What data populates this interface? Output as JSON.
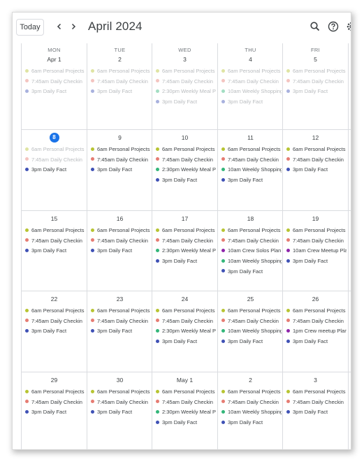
{
  "toolbar": {
    "today_label": "Today",
    "month_title": "April 2024",
    "icons": [
      "chevron-left-icon",
      "chevron-right-icon",
      "search-icon",
      "help-icon",
      "settings-icon"
    ]
  },
  "colors": {
    "personal": "#b7c432",
    "checkin": "#e67c73",
    "fact": "#3f51b5",
    "meal": "#33b679",
    "shopping": "#33b679",
    "crew": "#8e24aa",
    "today": "#1a73e8"
  },
  "days": [
    "MON",
    "TUE",
    "WED",
    "THU",
    "FRI"
  ],
  "weeks": [
    [
      {
        "date": "Apr 1",
        "events": [
          {
            "time": "6am",
            "title": "Personal Projects",
            "type": "personal",
            "past": true
          },
          {
            "time": "7:45am",
            "title": "Daily Checkin",
            "type": "checkin",
            "past": true
          },
          {
            "time": "3pm",
            "title": "Daily Fact",
            "type": "fact",
            "past": true
          }
        ]
      },
      {
        "date": "2",
        "events": [
          {
            "time": "6am",
            "title": "Personal Projects",
            "type": "personal",
            "past": true
          },
          {
            "time": "7:45am",
            "title": "Daily Checkin",
            "type": "checkin",
            "past": true
          },
          {
            "time": "3pm",
            "title": "Daily Fact",
            "type": "fact",
            "past": true
          }
        ]
      },
      {
        "date": "3",
        "events": [
          {
            "time": "6am",
            "title": "Personal Projects",
            "type": "personal",
            "past": true
          },
          {
            "time": "7:45am",
            "title": "Daily Checkin",
            "type": "checkin",
            "past": true
          },
          {
            "time": "2:30pm",
            "title": "Weekly Meal Prep",
            "type": "meal",
            "past": true
          },
          {
            "time": "3pm",
            "title": "Daily Fact",
            "type": "fact",
            "past": true
          }
        ]
      },
      {
        "date": "4",
        "events": [
          {
            "time": "6am",
            "title": "Personal Projects",
            "type": "personal",
            "past": true
          },
          {
            "time": "7:45am",
            "title": "Daily Checkin",
            "type": "checkin",
            "past": true
          },
          {
            "time": "10am",
            "title": "Weekly Shopping",
            "type": "shopping",
            "past": true
          },
          {
            "time": "3pm",
            "title": "Daily Fact",
            "type": "fact",
            "past": true
          }
        ]
      },
      {
        "date": "5",
        "events": [
          {
            "time": "6am",
            "title": "Personal Projects",
            "type": "personal",
            "past": true
          },
          {
            "time": "7:45am",
            "title": "Daily Checkin",
            "type": "checkin",
            "past": true
          },
          {
            "time": "3pm",
            "title": "Daily Fact",
            "type": "fact",
            "past": true
          }
        ]
      }
    ],
    [
      {
        "date": "8",
        "today": true,
        "events": [
          {
            "time": "6am",
            "title": "Personal Projects",
            "type": "personal",
            "past": true
          },
          {
            "time": "7:45am",
            "title": "Daily Checkin",
            "type": "checkin",
            "past": true
          },
          {
            "time": "3pm",
            "title": "Daily Fact",
            "type": "fact",
            "past": false
          }
        ]
      },
      {
        "date": "9",
        "events": [
          {
            "time": "6am",
            "title": "Personal Projects",
            "type": "personal"
          },
          {
            "time": "7:45am",
            "title": "Daily Checkin",
            "type": "checkin"
          },
          {
            "time": "3pm",
            "title": "Daily Fact",
            "type": "fact"
          }
        ]
      },
      {
        "date": "10",
        "events": [
          {
            "time": "6am",
            "title": "Personal Projects",
            "type": "personal"
          },
          {
            "time": "7:45am",
            "title": "Daily Checkin",
            "type": "checkin"
          },
          {
            "time": "2:30pm",
            "title": "Weekly Meal Prep",
            "type": "meal"
          },
          {
            "time": "3pm",
            "title": "Daily Fact",
            "type": "fact"
          }
        ]
      },
      {
        "date": "11",
        "events": [
          {
            "time": "6am",
            "title": "Personal Projects",
            "type": "personal"
          },
          {
            "time": "7:45am",
            "title": "Daily Checkin",
            "type": "checkin"
          },
          {
            "time": "10am",
            "title": "Weekly Shopping",
            "type": "shopping"
          },
          {
            "time": "3pm",
            "title": "Daily Fact",
            "type": "fact"
          }
        ]
      },
      {
        "date": "12",
        "events": [
          {
            "time": "6am",
            "title": "Personal Projects",
            "type": "personal"
          },
          {
            "time": "7:45am",
            "title": "Daily Checkin",
            "type": "checkin"
          },
          {
            "time": "3pm",
            "title": "Daily Fact",
            "type": "fact"
          }
        ]
      }
    ],
    [
      {
        "date": "15",
        "events": [
          {
            "time": "6am",
            "title": "Personal Projects",
            "type": "personal"
          },
          {
            "time": "7:45am",
            "title": "Daily Checkin",
            "type": "checkin"
          },
          {
            "time": "3pm",
            "title": "Daily Fact",
            "type": "fact"
          }
        ]
      },
      {
        "date": "16",
        "events": [
          {
            "time": "6am",
            "title": "Personal Projects",
            "type": "personal"
          },
          {
            "time": "7:45am",
            "title": "Daily Checkin",
            "type": "checkin"
          },
          {
            "time": "3pm",
            "title": "Daily Fact",
            "type": "fact"
          }
        ]
      },
      {
        "date": "17",
        "events": [
          {
            "time": "6am",
            "title": "Personal Projects",
            "type": "personal"
          },
          {
            "time": "7:45am",
            "title": "Daily Checkin",
            "type": "checkin"
          },
          {
            "time": "2:30pm",
            "title": "Weekly Meal Prep",
            "type": "meal"
          },
          {
            "time": "3pm",
            "title": "Daily Fact",
            "type": "fact"
          }
        ]
      },
      {
        "date": "18",
        "events": [
          {
            "time": "6am",
            "title": "Personal Projects",
            "type": "personal"
          },
          {
            "time": "7:45am",
            "title": "Daily Checkin",
            "type": "checkin"
          },
          {
            "time": "10am",
            "title": "Crew Solos Plan",
            "type": "crew"
          },
          {
            "time": "10am",
            "title": "Weekly Shopping",
            "type": "shopping"
          },
          {
            "time": "3pm",
            "title": "Daily Fact",
            "type": "fact"
          }
        ]
      },
      {
        "date": "19",
        "events": [
          {
            "time": "6am",
            "title": "Personal Projects",
            "type": "personal"
          },
          {
            "time": "7:45am",
            "title": "Daily Checkin",
            "type": "checkin"
          },
          {
            "time": "10am",
            "title": "Crew Meetup Plan",
            "type": "crew"
          },
          {
            "time": "3pm",
            "title": "Daily Fact",
            "type": "fact"
          }
        ]
      }
    ],
    [
      {
        "date": "22",
        "events": [
          {
            "time": "6am",
            "title": "Personal Projects",
            "type": "personal"
          },
          {
            "time": "7:45am",
            "title": "Daily Checkin",
            "type": "checkin"
          },
          {
            "time": "3pm",
            "title": "Daily Fact",
            "type": "fact"
          }
        ]
      },
      {
        "date": "23",
        "events": [
          {
            "time": "6am",
            "title": "Personal Projects",
            "type": "personal"
          },
          {
            "time": "7:45am",
            "title": "Daily Checkin",
            "type": "checkin"
          },
          {
            "time": "3pm",
            "title": "Daily Fact",
            "type": "fact"
          }
        ]
      },
      {
        "date": "24",
        "events": [
          {
            "time": "6am",
            "title": "Personal Projects",
            "type": "personal"
          },
          {
            "time": "7:45am",
            "title": "Daily Checkin",
            "type": "checkin"
          },
          {
            "time": "2:30pm",
            "title": "Weekly Meal Prep",
            "type": "meal"
          },
          {
            "time": "3pm",
            "title": "Daily Fact",
            "type": "fact"
          }
        ]
      },
      {
        "date": "25",
        "events": [
          {
            "time": "6am",
            "title": "Personal Projects",
            "type": "personal"
          },
          {
            "time": "7:45am",
            "title": "Daily Checkin",
            "type": "checkin"
          },
          {
            "time": "10am",
            "title": "Weekly Shopping",
            "type": "shopping"
          },
          {
            "time": "3pm",
            "title": "Daily Fact",
            "type": "fact"
          }
        ]
      },
      {
        "date": "26",
        "events": [
          {
            "time": "6am",
            "title": "Personal Projects",
            "type": "personal"
          },
          {
            "time": "7:45am",
            "title": "Daily Checkin",
            "type": "checkin"
          },
          {
            "time": "1pm",
            "title": "Crew meetup Plan",
            "type": "crew"
          },
          {
            "time": "3pm",
            "title": "Daily Fact",
            "type": "fact"
          }
        ]
      }
    ],
    [
      {
        "date": "29",
        "events": [
          {
            "time": "6am",
            "title": "Personal Projects",
            "type": "personal"
          },
          {
            "time": "7:45am",
            "title": "Daily Checkin",
            "type": "checkin"
          },
          {
            "time": "3pm",
            "title": "Daily Fact",
            "type": "fact"
          }
        ]
      },
      {
        "date": "30",
        "events": [
          {
            "time": "6am",
            "title": "Personal Projects",
            "type": "personal"
          },
          {
            "time": "7:45am",
            "title": "Daily Checkin",
            "type": "checkin"
          },
          {
            "time": "3pm",
            "title": "Daily Fact",
            "type": "fact"
          }
        ]
      },
      {
        "date": "May 1",
        "events": [
          {
            "time": "6am",
            "title": "Personal Projects",
            "type": "personal"
          },
          {
            "time": "7:45am",
            "title": "Daily Checkin",
            "type": "checkin"
          },
          {
            "time": "2:30pm",
            "title": "Weekly Meal Prep",
            "type": "meal"
          },
          {
            "time": "3pm",
            "title": "Daily Fact",
            "type": "fact"
          }
        ]
      },
      {
        "date": "2",
        "events": [
          {
            "time": "6am",
            "title": "Personal Projects",
            "type": "personal"
          },
          {
            "time": "7:45am",
            "title": "Daily Checkin",
            "type": "checkin"
          },
          {
            "time": "10am",
            "title": "Weekly Shopping",
            "type": "shopping"
          },
          {
            "time": "3pm",
            "title": "Daily Fact",
            "type": "fact"
          }
        ]
      },
      {
        "date": "3",
        "events": [
          {
            "time": "6am",
            "title": "Personal Projects",
            "type": "personal"
          },
          {
            "time": "7:45am",
            "title": "Daily Checkin",
            "type": "checkin"
          },
          {
            "time": "3pm",
            "title": "Daily Fact",
            "type": "fact"
          }
        ]
      }
    ]
  ]
}
